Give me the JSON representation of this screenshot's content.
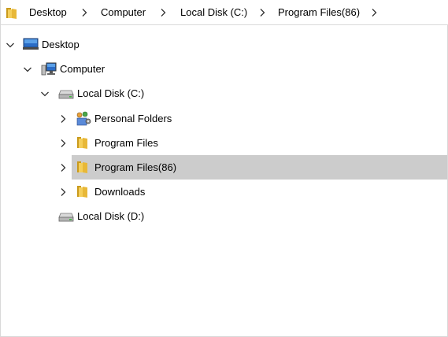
{
  "breadcrumb": {
    "items": [
      {
        "label": "Desktop"
      },
      {
        "label": "Computer"
      },
      {
        "label": "Local Disk (C:)"
      },
      {
        "label": "Program Files(86)"
      }
    ]
  },
  "tree": {
    "nodes": [
      {
        "label": "Desktop",
        "icon": "desktop-icon",
        "expander": "chevron-down-icon"
      },
      {
        "label": "Computer",
        "icon": "computer-icon",
        "expander": "chevron-down-icon"
      },
      {
        "label": "Local Disk (C:)",
        "icon": "drive-icon",
        "expander": "chevron-down-icon"
      },
      {
        "label": "Personal Folders",
        "icon": "personal-folders-icon",
        "expander": "chevron-right-icon"
      },
      {
        "label": "Program Files",
        "icon": "folder-icon",
        "expander": "chevron-right-icon"
      },
      {
        "label": "Program Files(86)",
        "icon": "folder-icon",
        "expander": "chevron-right-icon",
        "selected": true
      },
      {
        "label": "Downloads",
        "icon": "folder-icon",
        "expander": "chevron-right-icon"
      },
      {
        "label": "Local Disk (D:)",
        "icon": "drive-icon",
        "expander": ""
      }
    ]
  },
  "colors": {
    "selection": "#cccccc",
    "folder": "#e8b838",
    "border": "#d9d9d9",
    "chevron": "#333333"
  }
}
